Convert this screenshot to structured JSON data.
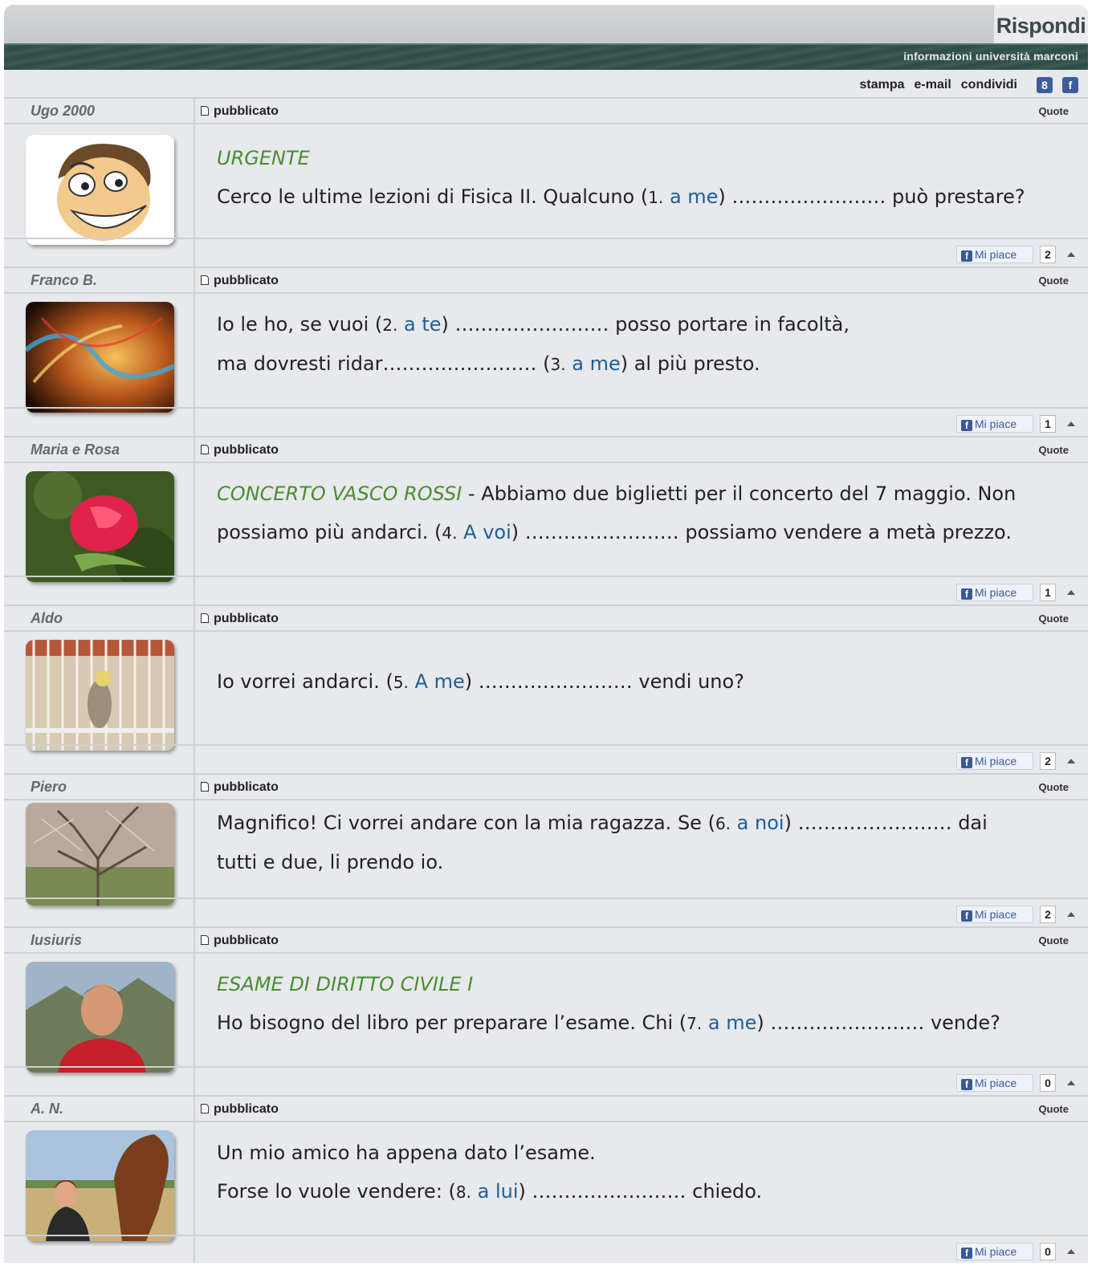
{
  "header": {
    "reply_label": "Rispondi",
    "subtitle": "informazioni università marconi",
    "tools": {
      "print": "stampa",
      "email": "e-mail",
      "share": "condividi",
      "gplus": "8",
      "facebook": "f"
    }
  },
  "labels": {
    "published": "pubblicato",
    "quote": "Quote",
    "like": "Mi piace",
    "fb_letter": "f"
  },
  "posts": [
    {
      "author": "Ugo 2000",
      "likes": "2",
      "avatar_icon": "cartoon-face",
      "title": "URGENTE",
      "line1_a": "Cerco le ultime lezioni di Fisica II. Qualcuno (",
      "num1": "1.",
      "hint1": "a me",
      "line1_b": ") …………………… può prestare?"
    },
    {
      "author": "Franco B.",
      "likes": "1",
      "avatar_icon": "abstract-swirl",
      "line1_a": "Io le ho, se vuoi (",
      "num1": "2.",
      "hint1": "a te",
      "line1_b": ") …………………… posso portare in facoltà,",
      "line2_a": "ma dovresti ridar…………………… (",
      "num2": "3.",
      "hint2": "a me",
      "line2_b": ") al più presto."
    },
    {
      "author": "Maria e Rosa",
      "likes": "1",
      "avatar_icon": "red-rose",
      "title": "CONCERTO VASCO ROSSI",
      "line1_b": " - Abbiamo due biglietti per il concerto del 7 maggio. Non",
      "line2_a": "possiamo più andarci. (",
      "num2": "4.",
      "hint2": "A voi",
      "line2_b": ") …………………… possiamo vendere a metà prezzo."
    },
    {
      "author": "Aldo",
      "likes": "2",
      "avatar_icon": "caged-bird",
      "line1_a": "Io vorrei andarci. (",
      "num1": "5.",
      "hint1": "A me",
      "line1_b": ") …………………… vendi uno?"
    },
    {
      "author": "Piero",
      "likes": "2",
      "avatar_icon": "bare-tree",
      "line1_a": "Magnifico! Ci vorrei andare con la mia ragazza. Se (",
      "num1": "6.",
      "hint1": "a noi",
      "line1_b": ") …………………… dai",
      "line2_a": "tutti e due, li prendo io."
    },
    {
      "author": "Iusiuris",
      "likes": "0",
      "avatar_icon": "young-man",
      "title": "ESAME DI DIRITTO CIVILE I",
      "line2_a": "Ho bisogno del libro per preparare l’esame. Chi (",
      "num2": "7.",
      "hint2": "a me",
      "line2_b": ") …………………… vende?"
    },
    {
      "author": "A. N.",
      "likes": "0",
      "avatar_icon": "woman-with-horse",
      "line1_a": "Un mio amico ha appena dato l’esame.",
      "line2_a": "Forse lo vuole vendere: (",
      "num2": "8.",
      "hint2": "a lui",
      "line2_b": ") …………………… chiedo."
    }
  ]
}
